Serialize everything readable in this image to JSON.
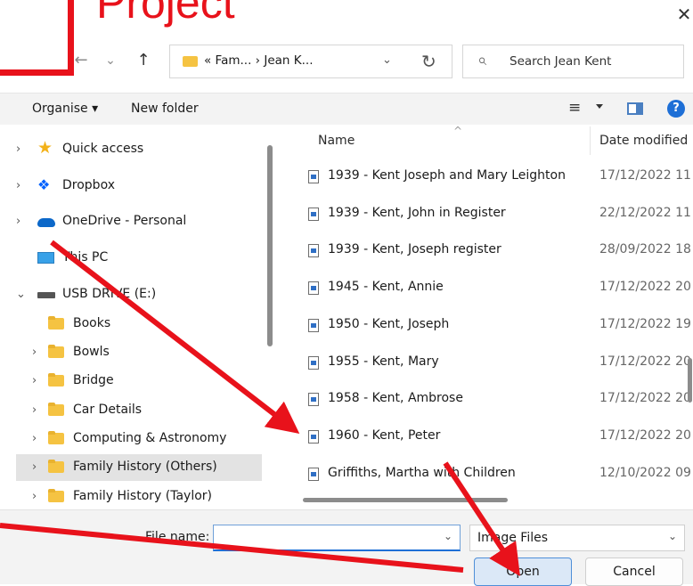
{
  "annotation": {
    "title": "Project"
  },
  "window": {
    "close_glyph": "✕"
  },
  "nav_buttons": {
    "back": "←",
    "forward": "→",
    "recent": "⌄",
    "up": "↑"
  },
  "address": {
    "crumbs": "« Fam...  ›  Jean K...",
    "dropdown": "⌄",
    "refresh": "↻"
  },
  "search": {
    "placeholder": "Search Jean Kent",
    "icon": "⌕"
  },
  "toolbar": {
    "organise": "Organise ▾",
    "new_folder": "New folder",
    "view_icon": "≡",
    "help": "?"
  },
  "sidebar": {
    "items": [
      {
        "label": "Quick access",
        "chev": "›",
        "icon": "star"
      },
      {
        "label": "Dropbox",
        "chev": "›",
        "icon": "dropbox"
      },
      {
        "label": "OneDrive - Personal",
        "chev": "›",
        "icon": "cloud"
      },
      {
        "label": "This PC",
        "chev": "",
        "icon": "pc"
      },
      {
        "label": "USB DRIVE (E:)",
        "chev": "⌄",
        "icon": "drive"
      },
      {
        "label": "Books",
        "chev": "",
        "icon": "folder"
      },
      {
        "label": "Bowls",
        "chev": "›",
        "icon": "folder"
      },
      {
        "label": "Bridge",
        "chev": "›",
        "icon": "folder"
      },
      {
        "label": "Car Details",
        "chev": "›",
        "icon": "folder"
      },
      {
        "label": "Computing & Astronomy",
        "chev": "›",
        "icon": "folder"
      },
      {
        "label": "Family History (Others)",
        "chev": "›",
        "icon": "folder",
        "selected": true
      },
      {
        "label": "Family History (Taylor)",
        "chev": "›",
        "icon": "folder"
      }
    ]
  },
  "file_list": {
    "columns": {
      "name": "Name",
      "date": "Date modified"
    },
    "sort_glyph": "^",
    "rows": [
      {
        "name": "1939 - Kent Joseph and Mary Leighton",
        "date": "17/12/2022 11"
      },
      {
        "name": "1939 - Kent, John in Register",
        "date": "22/12/2022 11"
      },
      {
        "name": "1939 - Kent, Joseph register",
        "date": "28/09/2022 18"
      },
      {
        "name": "1945 - Kent, Annie",
        "date": "17/12/2022 20"
      },
      {
        "name": "1950 - Kent, Joseph",
        "date": "17/12/2022 19"
      },
      {
        "name": "1955 - Kent, Mary",
        "date": "17/12/2022 20"
      },
      {
        "name": "1958 - Kent, Ambrose",
        "date": "17/12/2022 20"
      },
      {
        "name": "1960 - Kent, Peter",
        "date": "17/12/2022 20"
      },
      {
        "name": "Griffiths, Martha with Children",
        "date": "12/10/2022 09"
      }
    ]
  },
  "bottom": {
    "file_name_label": "File name:",
    "file_name_value": "",
    "file_type": "Image Files",
    "open": "Open",
    "cancel": "Cancel",
    "dropdown": "⌄"
  },
  "colors": {
    "annotation_red": "#e8121b",
    "accent": "#1e6fd6"
  }
}
